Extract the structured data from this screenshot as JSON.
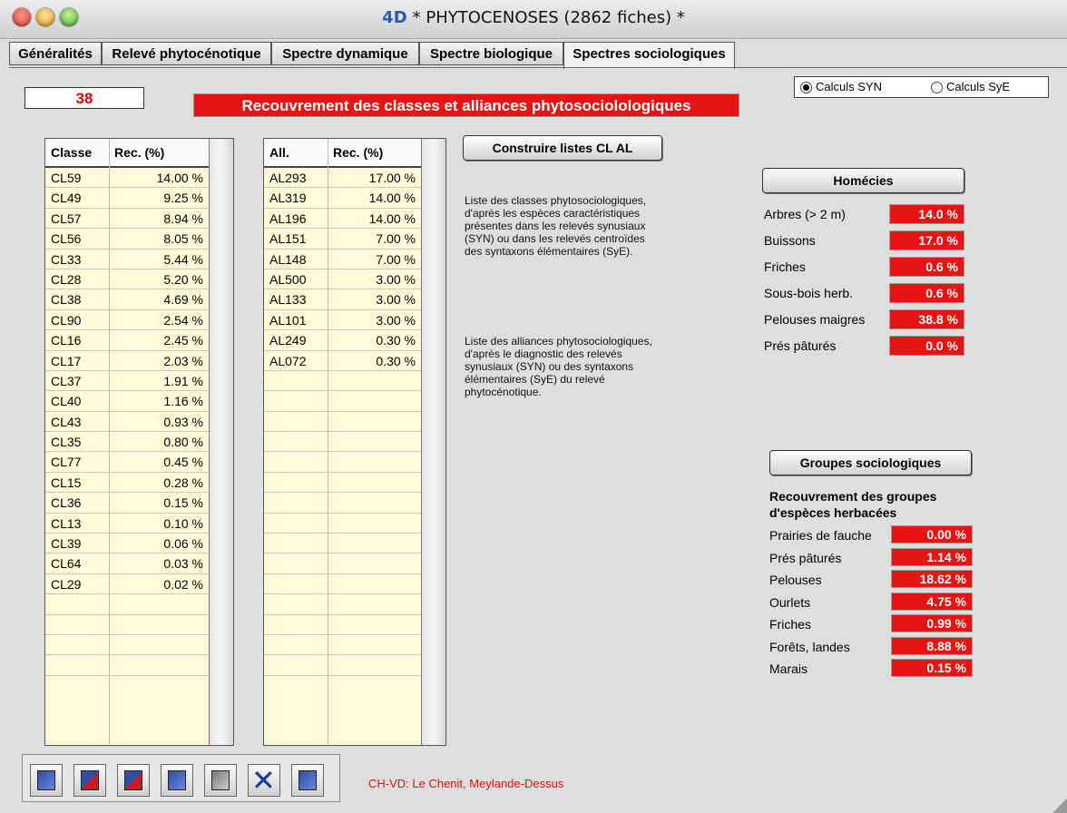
{
  "window": {
    "title": "* PHYTOCENOSES (2862 fiches) *",
    "logo": "4D"
  },
  "tabs": [
    {
      "label": "Généralités"
    },
    {
      "label": "Relevé phytocénotique"
    },
    {
      "label": "Spectre dynamique"
    },
    {
      "label": "Spectre biologique"
    },
    {
      "label": "Spectres sociologiques"
    }
  ],
  "record": {
    "count": "38"
  },
  "banner": {
    "text": "Recouvrement des classes et alliances phytosociolologiques"
  },
  "calc_mode": {
    "options": [
      {
        "label": "Calculs SYN",
        "selected": true
      },
      {
        "label": "Calculs SyE",
        "selected": false
      }
    ]
  },
  "classes_table": {
    "headers": [
      "Classe",
      "Rec. (%)"
    ],
    "rows": [
      [
        "CL59",
        "14.00 %"
      ],
      [
        "CL49",
        "9.25 %"
      ],
      [
        "CL57",
        "8.94 %"
      ],
      [
        "CL56",
        "8.05 %"
      ],
      [
        "CL33",
        "5.44 %"
      ],
      [
        "CL28",
        "5.20 %"
      ],
      [
        "CL38",
        "4.69 %"
      ],
      [
        "CL90",
        "2.54 %"
      ],
      [
        "CL16",
        "2.45 %"
      ],
      [
        "CL17",
        "2.03 %"
      ],
      [
        "CL37",
        "1.91 %"
      ],
      [
        "CL40",
        "1.16 %"
      ],
      [
        "CL43",
        "0.93 %"
      ],
      [
        "CL35",
        "0.80 %"
      ],
      [
        "CL77",
        "0.45 %"
      ],
      [
        "CL15",
        "0.28 %"
      ],
      [
        "CL36",
        "0.15 %"
      ],
      [
        "CL13",
        "0.10 %"
      ],
      [
        "CL39",
        "0.06 %"
      ],
      [
        "CL64",
        "0.03 %"
      ],
      [
        "CL29",
        "0.02 %"
      ],
      [
        "",
        ""
      ],
      [
        "",
        ""
      ],
      [
        "",
        ""
      ],
      [
        "",
        ""
      ]
    ]
  },
  "alliances_table": {
    "headers": [
      "All.",
      "Rec. (%)"
    ],
    "rows": [
      [
        "AL293",
        "17.00 %"
      ],
      [
        "AL319",
        "14.00 %"
      ],
      [
        "AL196",
        "14.00 %"
      ],
      [
        "AL151",
        "7.00 %"
      ],
      [
        "AL148",
        "7.00 %"
      ],
      [
        "AL500",
        "3.00 %"
      ],
      [
        "AL133",
        "3.00 %"
      ],
      [
        "AL101",
        "3.00 %"
      ],
      [
        "AL249",
        "0.30 %"
      ],
      [
        "AL072",
        "0.30 %"
      ],
      [
        "",
        ""
      ],
      [
        "",
        ""
      ],
      [
        "",
        ""
      ],
      [
        "",
        ""
      ],
      [
        "",
        ""
      ],
      [
        "",
        ""
      ],
      [
        "",
        ""
      ],
      [
        "",
        ""
      ],
      [
        "",
        ""
      ],
      [
        "",
        ""
      ],
      [
        "",
        ""
      ],
      [
        "",
        ""
      ],
      [
        "",
        ""
      ],
      [
        "",
        ""
      ],
      [
        "",
        ""
      ]
    ]
  },
  "build_button": {
    "label": "Construire listes CL AL"
  },
  "notes": {
    "classes": "Liste des classes phytosociologiques, d'après les espèces caractéristiques présentes dans les relevés synusiaux (SYN) ou dans les relevés centroïdes des syntaxons élémentaires (SyE).",
    "alliances": "Liste des alliances phytosociologiques, d'après le diagnostic des relevés synusiaux (SYN) ou des syntaxons élémentaires (SyE) du relevé phytocénotique."
  },
  "homecies": {
    "button_label": "Homécies",
    "items": [
      {
        "label": "Arbres (> 2 m)",
        "value": "14.0 %"
      },
      {
        "label": "Buissons",
        "value": "17.0 %"
      },
      {
        "label": "Friches",
        "value": "0.6 %"
      },
      {
        "label": "Sous-bois herb.",
        "value": "0.6 %"
      },
      {
        "label": "Pelouses maigres",
        "value": "38.8 %"
      },
      {
        "label": "Prés pâturés",
        "value": "0.0 %"
      }
    ]
  },
  "groupes": {
    "button_label": "Groupes sociologiques",
    "subtitle": "Recouvrement des groupes d'espèces herbacées",
    "items": [
      {
        "label": "Prairies de fauche",
        "value": "0.00 %"
      },
      {
        "label": "Prés pâturés",
        "value": "1.14 %"
      },
      {
        "label": "Pelouses",
        "value": "18.62 %"
      },
      {
        "label": "Ourlets",
        "value": "4.75 %"
      },
      {
        "label": "Friches",
        "value": "0.99 %"
      },
      {
        "label": "Forêts, landes",
        "value": "8.88 %"
      },
      {
        "label": "Marais",
        "value": "0.15 %"
      }
    ]
  },
  "toolbar": {
    "buttons": [
      {
        "icon": "first-record-icon"
      },
      {
        "icon": "previous-record-icon"
      },
      {
        "icon": "next-record-icon"
      },
      {
        "icon": "last-record-icon"
      },
      {
        "icon": "print-icon"
      },
      {
        "icon": "delete-icon"
      },
      {
        "icon": "save-icon"
      }
    ]
  },
  "location": {
    "text": "CH-VD: Le Chenit, Meylande-Dessus"
  },
  "colors": {
    "accent_red": "#e81414",
    "list_bg": "#fffbd9"
  }
}
